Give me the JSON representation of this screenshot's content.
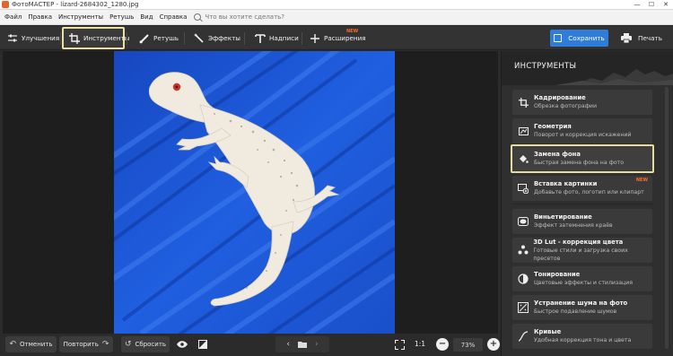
{
  "window": {
    "title": "ФотоМАСТЕР - lizard-2684302_1280.jpg",
    "buttons": [
      "—",
      "☐",
      "✕"
    ]
  },
  "menu": {
    "items": [
      "Файл",
      "Правка",
      "Инструменты",
      "Ретушь",
      "Вид",
      "Справка"
    ],
    "search_placeholder": "Что вы хотите сделать?"
  },
  "toolbar": {
    "tabs": [
      {
        "label": "Улучшения",
        "icon": "sliders-icon"
      },
      {
        "label": "Инструменты",
        "icon": "crop-icon",
        "active": true
      },
      {
        "label": "Ретушь",
        "icon": "brush-icon"
      },
      {
        "label": "Эффекты",
        "icon": "magic-wand-icon"
      },
      {
        "label": "Надписи",
        "icon": "text-icon"
      },
      {
        "label": "Расширения",
        "icon": "plus-icon",
        "badge": "NEW"
      }
    ],
    "save_label": "Сохранить",
    "print_label": "Печать"
  },
  "bottom": {
    "undo_label": "Отменить",
    "redo_label": "Повторить",
    "reset_label": "Сбросить",
    "ratio_label": "1:1",
    "zoom_value": "73%"
  },
  "panel": {
    "title": "ИНСТРУМЕНТЫ",
    "tools": [
      {
        "title": "Кадрирование",
        "desc": "Обрезка фотографии",
        "icon": "crop-icon"
      },
      {
        "title": "Геометрия",
        "desc": "Поворот и коррекция искажений",
        "icon": "geometry-icon"
      },
      {
        "title": "Замена фона",
        "desc": "Быстрая замена фона на фото",
        "icon": "paint-bucket-icon",
        "active": true
      },
      {
        "title": "Вставка картинки",
        "desc": "Добавьте фото, логотип или клипарт",
        "icon": "insert-image-icon",
        "badge": "NEW"
      },
      {
        "title": "Виньетирование",
        "desc": "Эффект затемнения краёв",
        "icon": "vignette-icon"
      },
      {
        "title": "3D Lut - коррекция цвета",
        "desc": "Готовые стили и загрузка своих пресетов",
        "icon": "lut-icon"
      },
      {
        "title": "Тонирование",
        "desc": "Цветовые эффекты и стилизация",
        "icon": "toning-icon"
      },
      {
        "title": "Устранение шума на фото",
        "desc": "Быстрое подавление шумов",
        "icon": "denoise-icon"
      },
      {
        "title": "Кривые",
        "desc": "Удобная коррекция тона и цвета",
        "icon": "curves-icon"
      }
    ]
  },
  "colors": {
    "accent": "#2f7dd8",
    "highlight": "#e8dc9a",
    "new_badge": "#ff6b2a",
    "photo_bg": "#1f56c8"
  }
}
